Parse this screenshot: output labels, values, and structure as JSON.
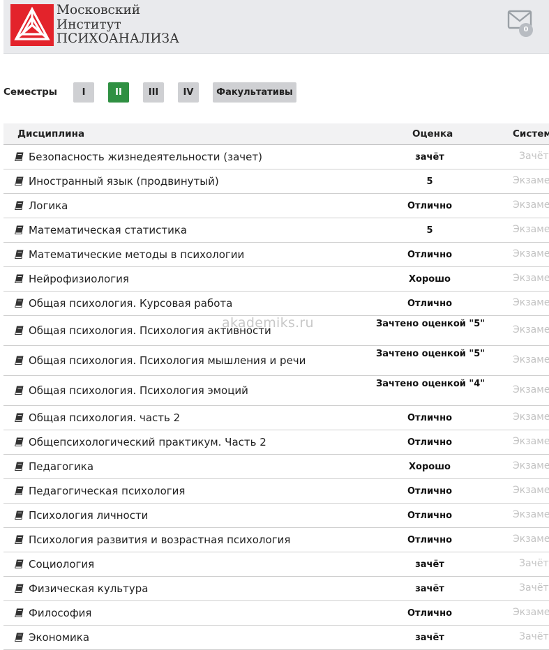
{
  "header": {
    "logo_lines": [
      "Московский",
      "Институт",
      "ПСИХОАНАЛИЗА"
    ],
    "logo_icon": "triangle-knot-logo",
    "mail_icon": "envelope-icon",
    "mail_count": "0",
    "brand_color": "#e3232b"
  },
  "semesters": {
    "label": "Семестры",
    "buttons": [
      "I",
      "II",
      "III",
      "IV",
      "Факультативы"
    ],
    "active": "II",
    "active_color": "#2f9042"
  },
  "table": {
    "columns": [
      "Дисциплина",
      "Оценка",
      "Система"
    ],
    "row_icon": "book-icon",
    "rows": [
      {
        "discipline": "Безопасность жизнедеятельности (зачет)",
        "grade": "зачёт",
        "system": "Зачёт"
      },
      {
        "discipline": "Иностранный язык (продвинутый)",
        "grade": "5",
        "system": "Экзамен"
      },
      {
        "discipline": "Логика",
        "grade": "Отлично",
        "system": "Экзамен"
      },
      {
        "discipline": "Математическая статистика",
        "grade": "5",
        "system": "Экзамен"
      },
      {
        "discipline": "Математические методы в психологии",
        "grade": "Отлично",
        "system": "Экзамен"
      },
      {
        "discipline": "Нейрофизиология",
        "grade": "Хорошо",
        "system": "Экзамен"
      },
      {
        "discipline": "Общая психология. Курсовая работа",
        "grade": "Отлично",
        "system": "Экзамен"
      },
      {
        "discipline": "Общая психология. Психология активности",
        "grade": "Зачтено оценкой \"5\"",
        "system": "Экзамен"
      },
      {
        "discipline": "Общая психология. Психология мышления и речи",
        "grade": "Зачтено оценкой \"5\"",
        "system": "Экзамен"
      },
      {
        "discipline": "Общая психология. Психология эмоций",
        "grade": "Зачтено оценкой \"4\"",
        "system": "Экзамен"
      },
      {
        "discipline": "Общая психология. часть 2",
        "grade": "Отлично",
        "system": "Экзамен"
      },
      {
        "discipline": "Общепсихологический практикум. Часть 2",
        "grade": "Отлично",
        "system": "Экзамен"
      },
      {
        "discipline": "Педагогика",
        "grade": "Хорошо",
        "system": "Экзамен"
      },
      {
        "discipline": "Педагогическая психология",
        "grade": "Отлично",
        "system": "Экзамен"
      },
      {
        "discipline": "Психология личности",
        "grade": "Отлично",
        "system": "Экзамен"
      },
      {
        "discipline": "Психология развития и возрастная психология",
        "grade": "Отлично",
        "system": "Экзамен"
      },
      {
        "discipline": "Социология",
        "grade": "зачёт",
        "system": "Зачёт"
      },
      {
        "discipline": "Физическая культура",
        "grade": "зачёт",
        "system": "Зачёт"
      },
      {
        "discipline": "Философия",
        "grade": "Отлично",
        "system": "Экзамен"
      },
      {
        "discipline": "Экономика",
        "grade": "зачёт",
        "system": "Зачёт"
      }
    ]
  },
  "watermark": "akademiks.ru"
}
